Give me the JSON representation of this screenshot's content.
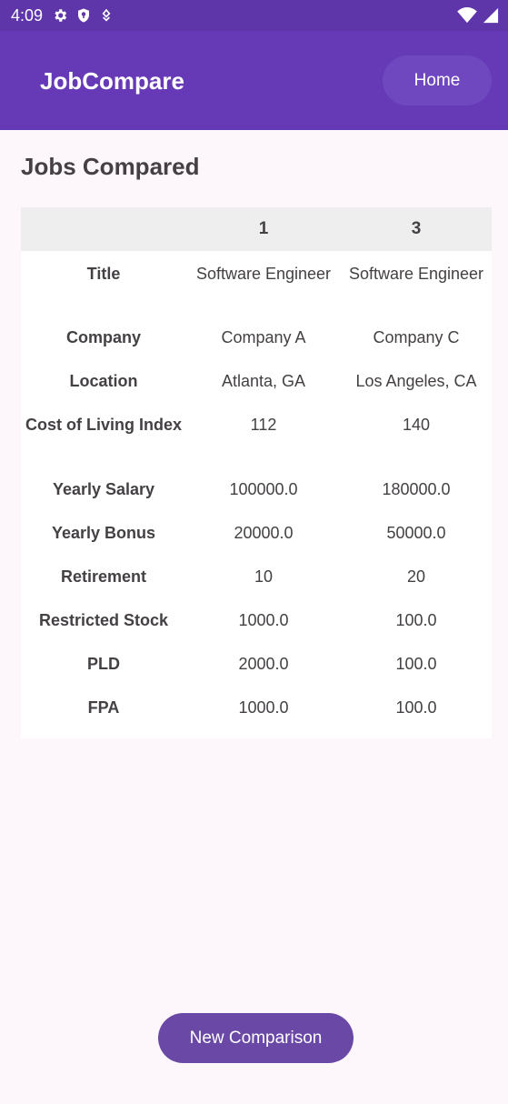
{
  "status": {
    "time": "4:09",
    "icons_left": [
      "gear-icon",
      "shield-icon",
      "location-icon"
    ],
    "icons_right": [
      "wifi-icon",
      "signal-icon"
    ]
  },
  "appbar": {
    "title": "JobCompare",
    "home_label": "Home"
  },
  "page": {
    "title": "Jobs Compared"
  },
  "table": {
    "headers": [
      "",
      "1",
      "3"
    ],
    "rows": [
      {
        "label": "Title",
        "a": "Software Engineer",
        "b": "Software Engineer"
      },
      {
        "label": "Company",
        "a": "Company A",
        "b": "Company C"
      },
      {
        "label": "Location",
        "a": "Atlanta, GA",
        "b": "Los Angeles, CA"
      },
      {
        "label": "Cost of Living Index",
        "a": "112",
        "b": "140"
      },
      {
        "label": "Yearly Salary",
        "a": "100000.0",
        "b": "180000.0"
      },
      {
        "label": "Yearly Bonus",
        "a": "20000.0",
        "b": "50000.0"
      },
      {
        "label": "Retirement",
        "a": "10",
        "b": "20"
      },
      {
        "label": "Restricted Stock",
        "a": "1000.0",
        "b": "100.0"
      },
      {
        "label": "PLD",
        "a": "2000.0",
        "b": "100.0"
      },
      {
        "label": "FPA",
        "a": "1000.0",
        "b": "100.0"
      }
    ]
  },
  "footer": {
    "new_comparison_label": "New Comparison"
  },
  "colors": {
    "appbar": "#6639b7",
    "statusbar": "#5f35aa",
    "button": "#6a48a6",
    "background": "#fdf7fc"
  }
}
